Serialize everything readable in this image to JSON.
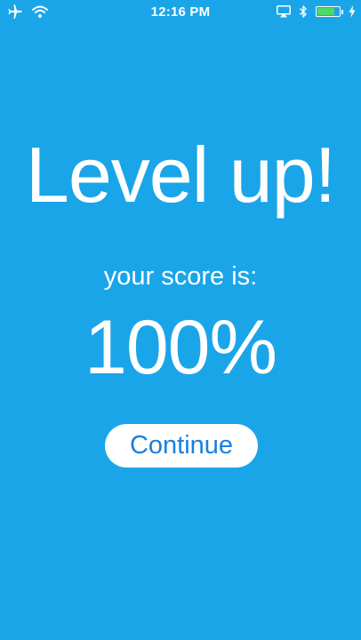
{
  "status_bar": {
    "time": "12:16 PM",
    "battery_fill_fraction": 0.8,
    "battery_color": "#4CD964",
    "icons": [
      "airplane-icon",
      "wifi-icon",
      "airplay-icon",
      "bluetooth-icon",
      "battery-icon",
      "charging-bolt-icon"
    ]
  },
  "screen": {
    "background_color": "#1AA5E9",
    "title": "Level up!",
    "score_label": "your score is:",
    "score_value": "100%",
    "continue_label": "Continue",
    "button_text_color": "#1A7FDE"
  }
}
